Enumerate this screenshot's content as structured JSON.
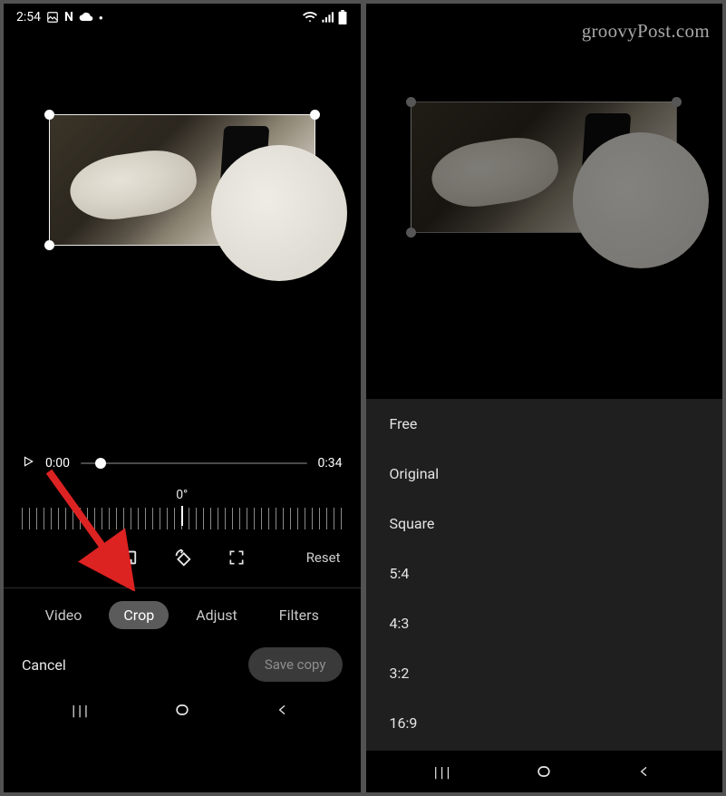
{
  "watermark": "groovyPost.com",
  "status": {
    "time": "2:54",
    "icons_left": [
      "image-icon",
      "netflix-icon",
      "cloud-icon",
      "dot-icon"
    ],
    "icons_right": [
      "wifi-icon",
      "signal-icon",
      "battery-icon"
    ]
  },
  "player": {
    "current_time": "0:00",
    "duration": "0:34"
  },
  "dial": {
    "angle": "0°"
  },
  "crop_tools": {
    "reset": "Reset"
  },
  "tabs": {
    "items": [
      "Video",
      "Crop",
      "Adjust",
      "Filters"
    ],
    "active": "Crop"
  },
  "actions": {
    "cancel": "Cancel",
    "save": "Save copy"
  },
  "aspect_ratios": [
    "Free",
    "Original",
    "Square",
    "5:4",
    "4:3",
    "3:2",
    "16:9"
  ]
}
